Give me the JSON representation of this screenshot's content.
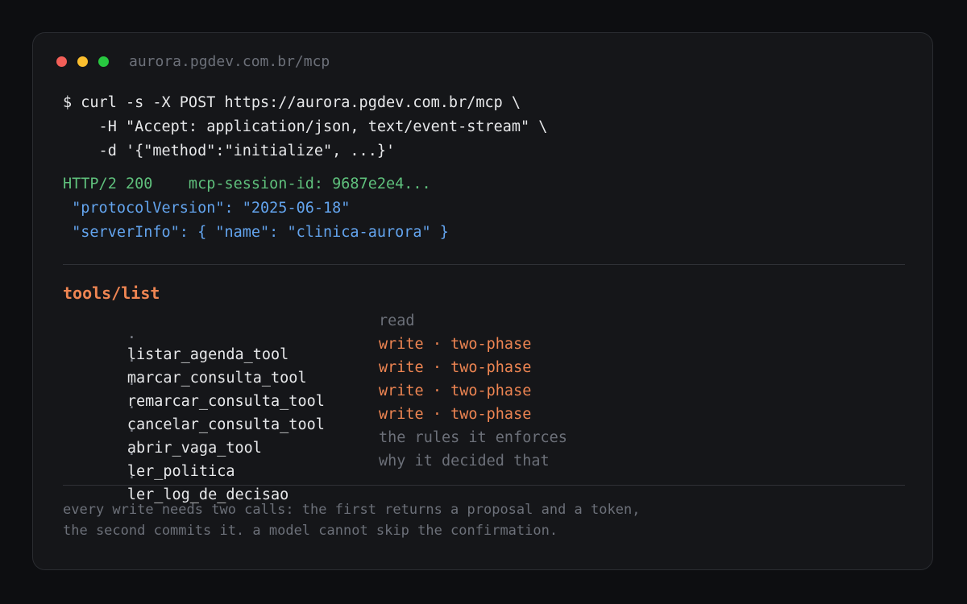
{
  "window": {
    "url": "aurora.pgdev.com.br/mcp",
    "traffic_lights": {
      "close": "#f25f58",
      "minimize": "#fbbe2e",
      "maximize": "#28c840"
    }
  },
  "request": {
    "lines": [
      "$ curl -s -X POST https://aurora.pgdev.com.br/mcp \\",
      "    -H \"Accept: application/json, text/event-stream\" \\",
      "    -d '{\"method\":\"initialize\", ...}'"
    ]
  },
  "response": {
    "status": "HTTP/2 200    mcp-session-id: 9687e2e4...",
    "body_lines": [
      " \"protocolVersion\": \"2025-06-18\"",
      " \"serverInfo\": { \"name\": \"clinica-aurora\" }"
    ]
  },
  "tools": {
    "title": "tools/list",
    "bullet": "·",
    "items": [
      {
        "name": "listar_agenda_tool",
        "mode": "read",
        "kind": "read"
      },
      {
        "name": "marcar_consulta_tool",
        "mode": "write · two-phase",
        "kind": "write"
      },
      {
        "name": "remarcar_consulta_tool",
        "mode": "write · two-phase",
        "kind": "write"
      },
      {
        "name": "cancelar_consulta_tool",
        "mode": "write · two-phase",
        "kind": "write"
      },
      {
        "name": "abrir_vaga_tool",
        "mode": "write · two-phase",
        "kind": "write"
      },
      {
        "name": "ler_politica",
        "mode": "the rules it enforces",
        "kind": "read"
      },
      {
        "name": "ler_log_de_decisao",
        "mode": "why it decided that",
        "kind": "read"
      }
    ]
  },
  "footnote": {
    "lines": [
      "every write needs two calls: the first returns a proposal and a token,",
      "the second commits it. a model cannot skip the confirmation."
    ]
  },
  "colors": {
    "background": "#0d0e11",
    "panel": "#151619",
    "text": "#e7e8ea",
    "muted": "#6c7079",
    "success": "#5fc07c",
    "json": "#63a4ee",
    "accent": "#ee8552"
  }
}
